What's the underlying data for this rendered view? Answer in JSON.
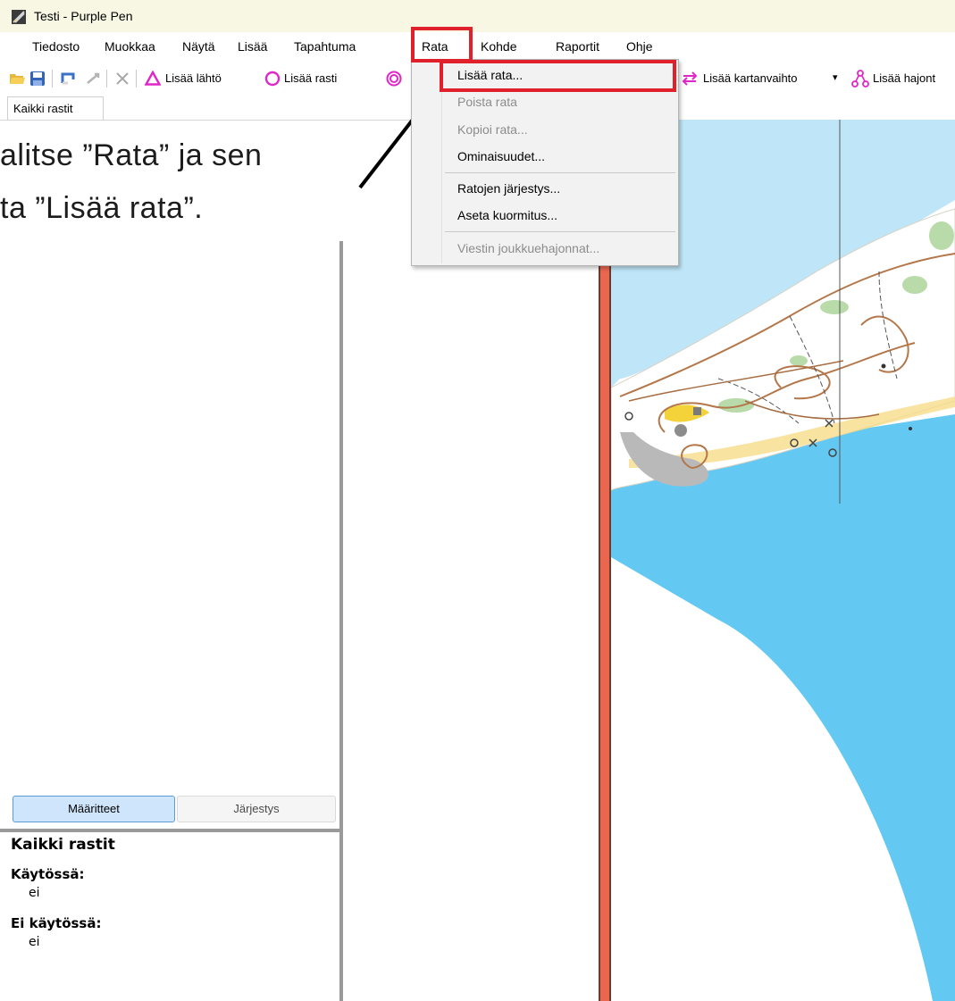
{
  "window": {
    "title": "Testi - Purple Pen"
  },
  "menu": {
    "items": [
      "Tiedosto",
      "Muokkaa",
      "Näytä",
      "Lisää",
      "Tapahtuma",
      "Rata",
      "Kohde",
      "Raportit",
      "Ohje"
    ]
  },
  "toolbar": {
    "add_start": "Lisää lähtö",
    "add_control": "Lisää rasti",
    "add_map_exchange": "Lisää kartanvaihto",
    "add_variation": "Lisää hajont",
    "dropdown_arrow": "▾"
  },
  "course_tab": {
    "label": "Kaikki rastit"
  },
  "instruction": {
    "line1": "alitse ”Rata” ja sen",
    "line2": "ta ”Lisää rata”."
  },
  "dropdown": {
    "items": [
      {
        "label": "Lisää rata...",
        "enabled": true
      },
      {
        "label": "Poista rata",
        "enabled": false
      },
      {
        "label": "Kopioi rata...",
        "enabled": false
      },
      {
        "label": "Ominaisuudet...",
        "enabled": true
      },
      {
        "label": "Ratojen järjestys...",
        "enabled": true
      },
      {
        "label": "Aseta kuormitus...",
        "enabled": true
      },
      {
        "label": "Viestin joukkuehajonnat...",
        "enabled": false
      }
    ]
  },
  "panel": {
    "tabs": [
      "Määritteet",
      "Järjestys"
    ],
    "heading": "Kaikki rastit",
    "in_use_label": "Käytössä:",
    "in_use_value": "ei",
    "not_in_use_label": "Ei käytössä:",
    "not_in_use_value": "ei"
  },
  "colors": {
    "highlight": "#e0202a",
    "water": "#63c9f2",
    "light_water": "#bfe6f8",
    "purple": "#e026c8",
    "map_edge": "#e9664f"
  },
  "icons": [
    "app-icon",
    "open-folder-icon",
    "save-icon",
    "undo-icon",
    "redo-icon",
    "delete-icon",
    "start-triangle-icon",
    "control-circle-icon",
    "finish-icon",
    "map-exchange-icon",
    "variation-icon",
    "arrow-annotation"
  ]
}
